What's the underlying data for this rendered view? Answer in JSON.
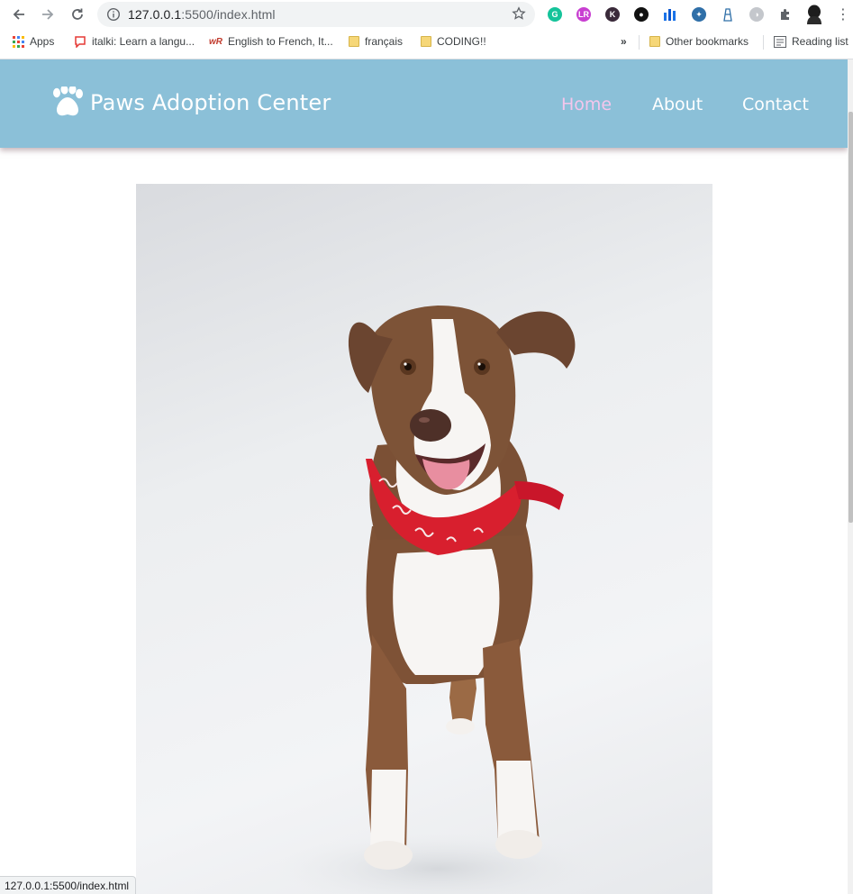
{
  "browser": {
    "url_host": "127.0.0.1",
    "url_rest": ":5500/index.html",
    "status_url": "127.0.0.1:5500/index.html",
    "bookmarks": [
      {
        "label": "Apps",
        "icon": "apps-grid-icon"
      },
      {
        "label": "italki: Learn a langu...",
        "icon": "italki-icon"
      },
      {
        "label": "English to French, It...",
        "icon": "wordreference-icon"
      },
      {
        "label": "français",
        "icon": "folder-icon"
      },
      {
        "label": "CODING!!",
        "icon": "folder-icon"
      }
    ],
    "overflow_chevron": "»",
    "other_bookmarks": "Other bookmarks",
    "reading_list": "Reading list"
  },
  "site": {
    "brand": "Paws Adoption Center",
    "brand_icon": "paw-icon",
    "nav": [
      {
        "label": "Home",
        "active": true
      },
      {
        "label": "About",
        "active": false
      },
      {
        "label": "Contact",
        "active": false
      }
    ],
    "colors": {
      "header": "#8bc0d8",
      "active_link": "#f4c6ec",
      "link": "#ffffff"
    },
    "hero_image": "dog-photo"
  }
}
